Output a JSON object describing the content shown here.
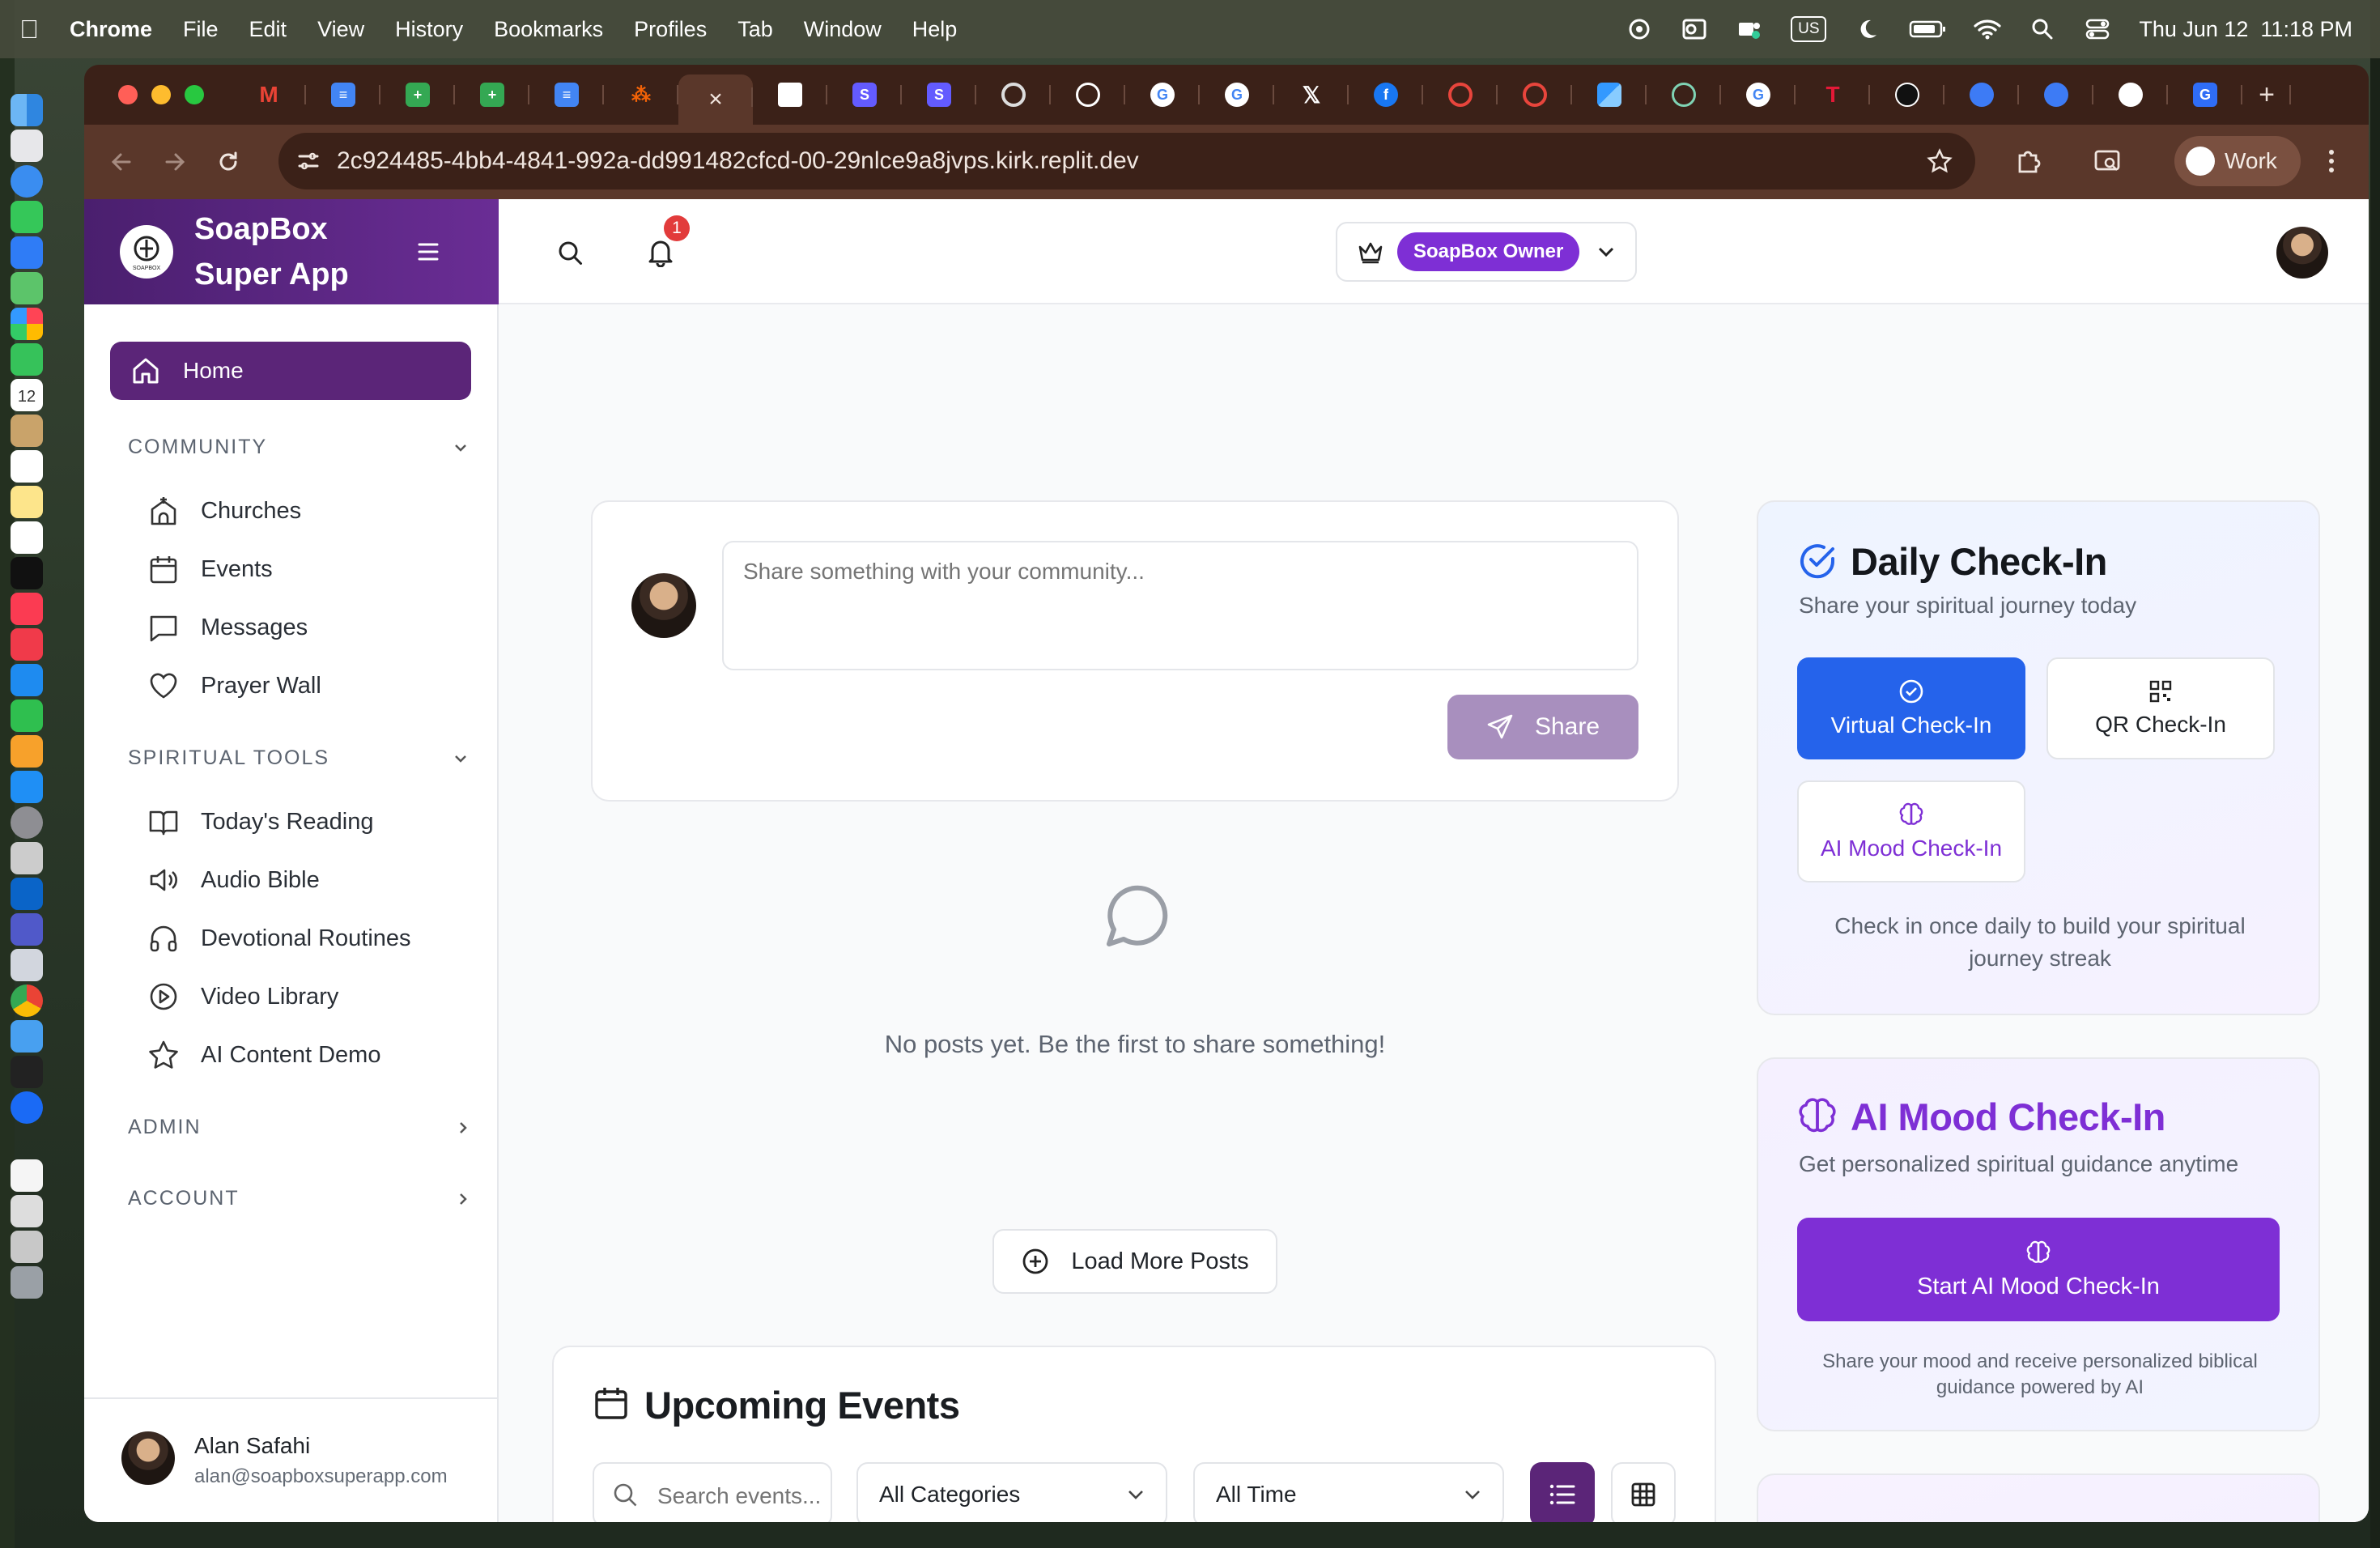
{
  "menubar": {
    "app": "Chrome",
    "items": [
      "File",
      "Edit",
      "View",
      "History",
      "Bookmarks",
      "Profiles",
      "Tab",
      "Window",
      "Help"
    ],
    "status_input": "US",
    "datetime": "Thu Jun 12  11:18 PM"
  },
  "browser": {
    "url": "2c924485-4bb4-4841-992a-dd991482cfcd-00-29nlce9a8jvps.kirk.replit.dev",
    "profile_label": "Work"
  },
  "app": {
    "brand": {
      "line1": "SoapBox",
      "line2": "Super App",
      "logo_text": "SOAPBOX"
    },
    "nav": {
      "home": "Home",
      "community": {
        "label": "COMMUNITY",
        "items": [
          "Churches",
          "Events",
          "Messages",
          "Prayer Wall"
        ]
      },
      "spiritual_tools": {
        "label": "SPIRITUAL TOOLS",
        "items": [
          "Today's Reading",
          "Audio Bible",
          "Devotional Routines",
          "Video Library",
          "AI Content Demo"
        ]
      },
      "admin": "ADMIN",
      "account": "ACCOUNT"
    },
    "user": {
      "name": "Alan Safahi",
      "email": "alan@soapboxsuperapp.com"
    },
    "topbar": {
      "notification_count": "1",
      "role_label": "SoapBox Owner"
    },
    "composer": {
      "placeholder": "Share something with your community...",
      "share_label": "Share"
    },
    "feed": {
      "empty_text": "No posts yet. Be the first to share something!",
      "load_more": "Load More Posts"
    },
    "events": {
      "title": "Upcoming Events",
      "search_placeholder": "Search events...",
      "category_value": "All Categories",
      "time_value": "All Time"
    },
    "checkin": {
      "title": "Daily Check-In",
      "subtitle": "Share your spiritual journey today",
      "virtual": "Virtual Check-In",
      "qr": "QR Check-In",
      "ai_mood": "AI Mood Check-In",
      "note": "Check in once daily to build your spiritual journey streak"
    },
    "ai_mood": {
      "title": "AI Mood Check-In",
      "subtitle": "Get personalized spiritual guidance anytime",
      "button": "Start AI Mood Check-In",
      "note": "Share your mood and receive personalized biblical guidance powered by AI"
    }
  },
  "colors": {
    "brand_purple": "#5b2578",
    "accent_purple": "#7e2fd5",
    "blue": "#2563eb",
    "badge_red": "#e23b3b"
  }
}
